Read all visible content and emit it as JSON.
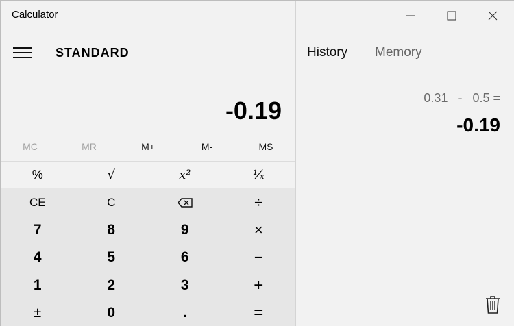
{
  "app": {
    "title": "Calculator"
  },
  "header": {
    "mode": "STANDARD"
  },
  "display": {
    "value": "-0.19"
  },
  "memory_buttons": [
    {
      "label": "MC",
      "enabled": false
    },
    {
      "label": "MR",
      "enabled": false
    },
    {
      "label": "M+",
      "enabled": true
    },
    {
      "label": "M-",
      "enabled": true
    },
    {
      "label": "MS",
      "enabled": true
    }
  ],
  "keys": {
    "row1": [
      "%",
      "√",
      "x²",
      "¹⁄ₓ"
    ],
    "row2": [
      "CE",
      "C",
      "backspace",
      "÷"
    ],
    "row3": [
      "7",
      "8",
      "9",
      "×"
    ],
    "row4": [
      "4",
      "5",
      "6",
      "−"
    ],
    "row5": [
      "1",
      "2",
      "3",
      "+"
    ],
    "row6": [
      "±",
      "0",
      ".",
      "="
    ]
  },
  "side": {
    "tabs": {
      "history": "History",
      "memory": "Memory"
    },
    "history": [
      {
        "expression": "0.31   -   0.5 =",
        "result": "-0.19"
      }
    ]
  },
  "icons": {
    "menu": "hamburger-icon",
    "minimize": "minimize-icon",
    "maximize": "maximize-icon",
    "close": "close-icon",
    "backspace": "backspace-icon",
    "trash": "trash-icon"
  }
}
